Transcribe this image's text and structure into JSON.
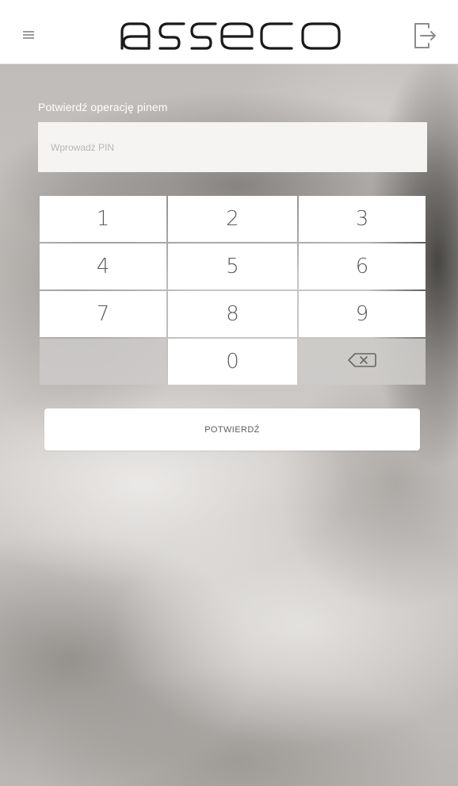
{
  "header": {
    "logo_text": "asseco",
    "menu_icon": "hamburger-menu-icon",
    "logout_icon": "logout-icon"
  },
  "pin_form": {
    "label": "Potwierdź operację pinem",
    "input_placeholder": "Wprowadź PIN",
    "input_value": ""
  },
  "keypad": {
    "keys": [
      "1",
      "2",
      "3",
      "4",
      "5",
      "6",
      "7",
      "8",
      "9",
      "",
      "0",
      "backspace"
    ],
    "backspace_icon": "backspace-icon"
  },
  "confirm_button": {
    "label": "POTWIERDŹ"
  },
  "colors": {
    "header_bg": "#ffffff",
    "key_bg": "#ffffff",
    "key_muted_bg": "#cdcbc9",
    "text_dark": "#5a5a5a"
  }
}
